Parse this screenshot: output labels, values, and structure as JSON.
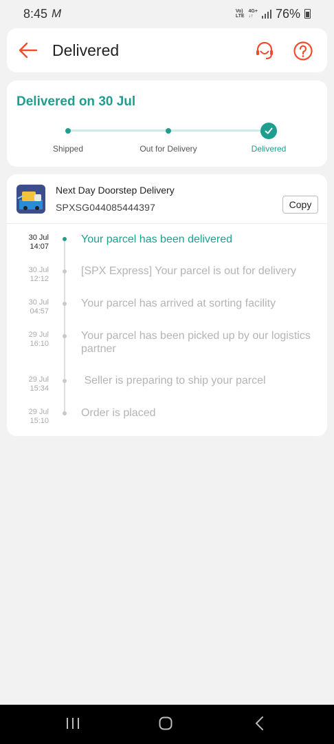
{
  "status_bar": {
    "time": "8:45",
    "carrier_logo": "M",
    "volte_top": "Vo)",
    "volte_bottom": "LTE",
    "net_top": "4G+",
    "net_bottom": "↓↑",
    "battery": "76%"
  },
  "header": {
    "title": "Delivered",
    "back_icon": "arrow-left-icon",
    "support_icon": "headset-icon",
    "help_icon": "question-circle-icon",
    "accent_color": "#ee4d2d"
  },
  "progress": {
    "title": "Delivered on 30 Jul",
    "steps": [
      {
        "label": "Shipped",
        "state": "done"
      },
      {
        "label": "Out for Delivery",
        "state": "done"
      },
      {
        "label": "Delivered",
        "state": "current"
      }
    ],
    "accent_color": "#1f9e8f"
  },
  "shipment": {
    "service": "Next Day Doorstep Delivery",
    "tracking_number": "SPXSG044085444397",
    "copy_label": "Copy",
    "events": [
      {
        "date": "30 Jul",
        "time": "14:07",
        "text": "Your parcel has been delivered",
        "active": true
      },
      {
        "date": "30 Jul",
        "time": "12:12",
        "text": "[SPX Express] Your parcel is out for delivery",
        "active": false
      },
      {
        "date": "30 Jul",
        "time": "04:57",
        "text": "Your parcel has arrived at sorting facility",
        "active": false
      },
      {
        "date": "29 Jul",
        "time": "16:10",
        "text": "Your parcel has been picked up by our logistics partner",
        "active": false
      },
      {
        "date": "29 Jul",
        "time": "15:34",
        "text": " Seller is preparing to ship your parcel",
        "active": false
      },
      {
        "date": "29 Jul",
        "time": "15:10",
        "text": "Order is placed",
        "active": false
      }
    ]
  },
  "nav": {
    "recents_icon": "recents-icon",
    "home_icon": "home-icon",
    "back_icon": "back-icon"
  }
}
